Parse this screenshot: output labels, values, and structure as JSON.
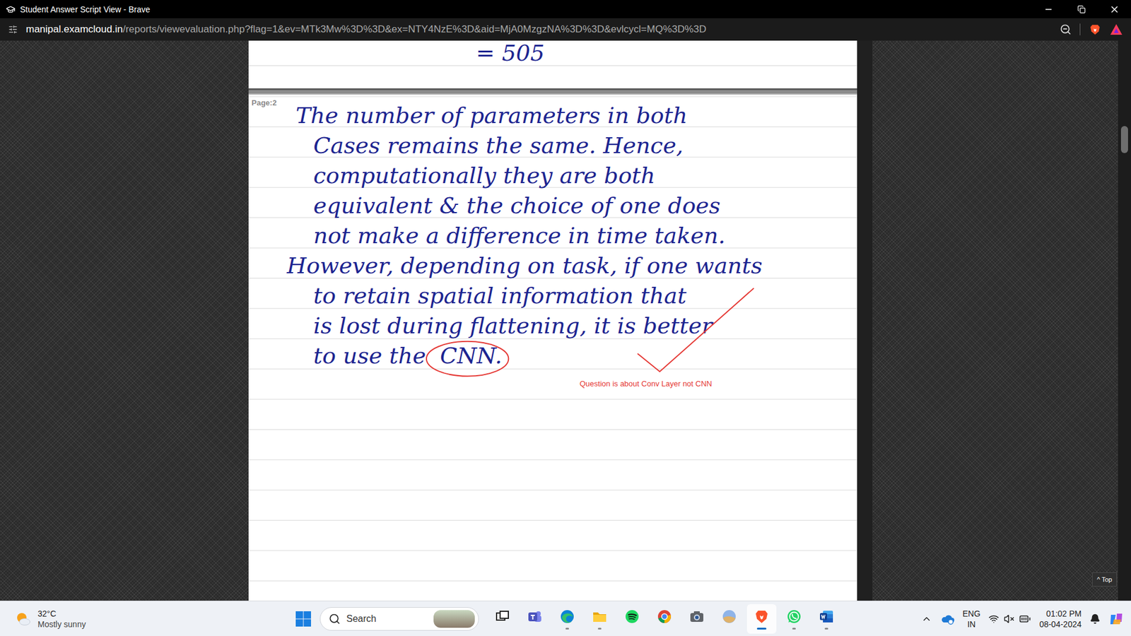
{
  "window": {
    "title": "Student Answer Script View - Brave"
  },
  "address_bar": {
    "domain": "manipal.examcloud.in",
    "path": "/reports/viewevaluation.php?flag=1&ev=MTk3Mw%3D%3D&ex=NTY4NzE%3D&aid=MjA0MzgzNA%3D%3D&evlcycl=MQ%3D%3D"
  },
  "previous_page": {
    "text": "= 505"
  },
  "page": {
    "label": "Page:2",
    "lines": [
      {
        "text": "The number of parameters in both"
      },
      {
        "text": "Cases remains the same. Hence,"
      },
      {
        "text": "computationally they are both"
      },
      {
        "text": "equivalent & the choice of one does"
      },
      {
        "text": "not make a difference in time taken."
      },
      {
        "text": "However, depending on task, if one wants"
      },
      {
        "text": "to retain spatial information that"
      },
      {
        "text": "is lost during flattening, it is better"
      },
      {
        "text": "to use the",
        "circled": "CNN."
      }
    ],
    "annotation": {
      "comment": "Question is about Conv Layer not CNN",
      "tick": true
    }
  },
  "scrollbar": {
    "level": 0.16
  },
  "top_button": "^ Top",
  "taskbar": {
    "weather": {
      "temperature": "32°C",
      "condition": "Mostly sunny"
    },
    "search": {
      "placeholder": "Search"
    },
    "apps": [
      {
        "kind": "taskview",
        "running": false,
        "active": false
      },
      {
        "kind": "teams",
        "running": false,
        "active": false
      },
      {
        "kind": "edge",
        "running": true,
        "active": false
      },
      {
        "kind": "explorer",
        "running": true,
        "active": false
      },
      {
        "kind": "spotify",
        "running": false,
        "active": false
      },
      {
        "kind": "chrome",
        "running": false,
        "active": false
      },
      {
        "kind": "camera",
        "running": false,
        "active": false
      },
      {
        "kind": "photos",
        "running": false,
        "active": false
      },
      {
        "kind": "brave",
        "running": true,
        "active": true
      },
      {
        "kind": "whatsapp",
        "running": true,
        "active": false
      },
      {
        "kind": "word",
        "running": true,
        "active": false
      }
    ],
    "tray": {
      "language": "ENG",
      "region": "IN",
      "volume_muted": true,
      "time": "01:02 PM",
      "date": "08-04-2024"
    }
  }
}
